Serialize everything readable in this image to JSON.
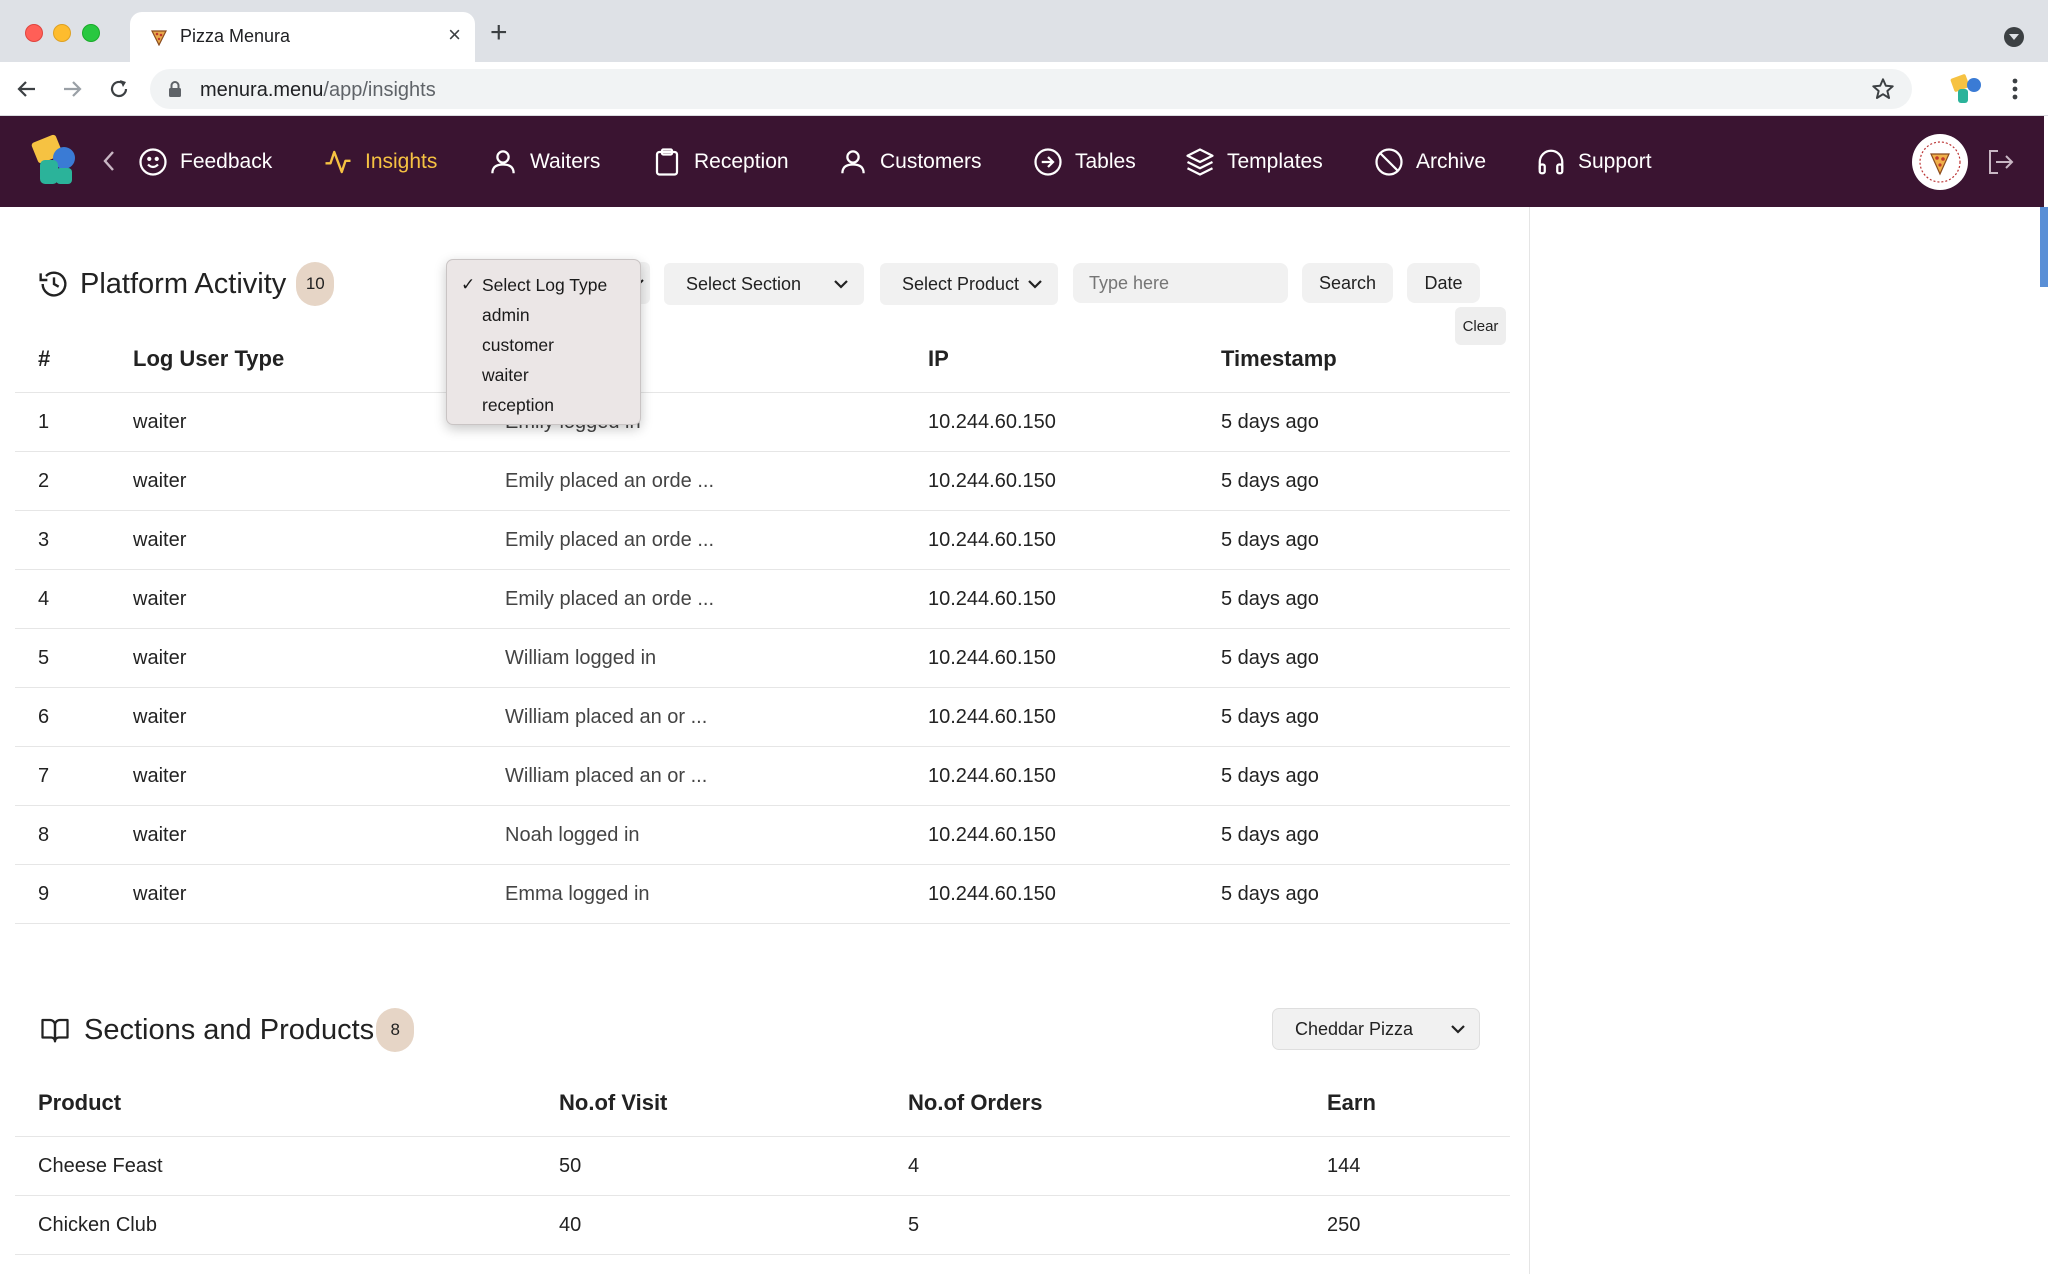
{
  "browser": {
    "tab_title": "Pizza Menura",
    "new_tab": "+",
    "close": "×",
    "url_host": "menura.menu",
    "url_path": "/app/insights"
  },
  "nav": {
    "items": [
      {
        "label": "Feedback",
        "icon": "smile-icon"
      },
      {
        "label": "Insights",
        "icon": "activity-icon",
        "active": true
      },
      {
        "label": "Waiters",
        "icon": "user-icon"
      },
      {
        "label": "Reception",
        "icon": "clipboard-icon"
      },
      {
        "label": "Customers",
        "icon": "user-icon"
      },
      {
        "label": "Tables",
        "icon": "arrow-right-circle-icon"
      },
      {
        "label": "Templates",
        "icon": "layers-icon"
      },
      {
        "label": "Archive",
        "icon": "slash-icon"
      },
      {
        "label": "Support",
        "icon": "headphones-icon"
      }
    ],
    "colors": {
      "bar": "#3a1431",
      "active": "#f6c242"
    }
  },
  "activity": {
    "title": "Platform Activity",
    "count": "10",
    "filters": {
      "log_type": {
        "options": [
          "Select Log Type",
          "admin",
          "customer",
          "waiter",
          "reception"
        ],
        "selected": "Select Log Type"
      },
      "section": "Select Section",
      "product": "Select Product",
      "search_placeholder": "Type here",
      "search_label": "Search",
      "date_label": "Date",
      "clear_label": "Clear"
    },
    "columns": [
      "#",
      "Log User Type",
      "IP",
      "Timestamp"
    ],
    "rows": [
      {
        "n": "1",
        "type": "waiter",
        "desc": "Emily logged in",
        "ip": "10.244.60.150",
        "time": "5 days ago"
      },
      {
        "n": "2",
        "type": "waiter",
        "desc": "Emily placed an orde ...",
        "ip": "10.244.60.150",
        "time": "5 days ago"
      },
      {
        "n": "3",
        "type": "waiter",
        "desc": "Emily placed an orde ...",
        "ip": "10.244.60.150",
        "time": "5 days ago"
      },
      {
        "n": "4",
        "type": "waiter",
        "desc": "Emily placed an orde ...",
        "ip": "10.244.60.150",
        "time": "5 days ago"
      },
      {
        "n": "5",
        "type": "waiter",
        "desc": "William logged in",
        "ip": "10.244.60.150",
        "time": "5 days ago"
      },
      {
        "n": "6",
        "type": "waiter",
        "desc": "William placed an or ...",
        "ip": "10.244.60.150",
        "time": "5 days ago"
      },
      {
        "n": "7",
        "type": "waiter",
        "desc": "William placed an or ...",
        "ip": "10.244.60.150",
        "time": "5 days ago"
      },
      {
        "n": "8",
        "type": "waiter",
        "desc": "Noah logged in",
        "ip": "10.244.60.150",
        "time": "5 days ago"
      },
      {
        "n": "9",
        "type": "waiter",
        "desc": "Emma logged in",
        "ip": "10.244.60.150",
        "time": "5 days ago"
      }
    ]
  },
  "sections": {
    "title": "Sections and Products",
    "count": "8",
    "selected_product": "Cheddar Pizza",
    "columns": [
      "Product",
      "No.of Visit",
      "No.of Orders",
      "Earn"
    ],
    "rows": [
      {
        "product": "Cheese Feast",
        "visits": "50",
        "orders": "4",
        "earn": "144"
      },
      {
        "product": "Chicken Club",
        "visits": "40",
        "orders": "5",
        "earn": "250"
      }
    ]
  }
}
